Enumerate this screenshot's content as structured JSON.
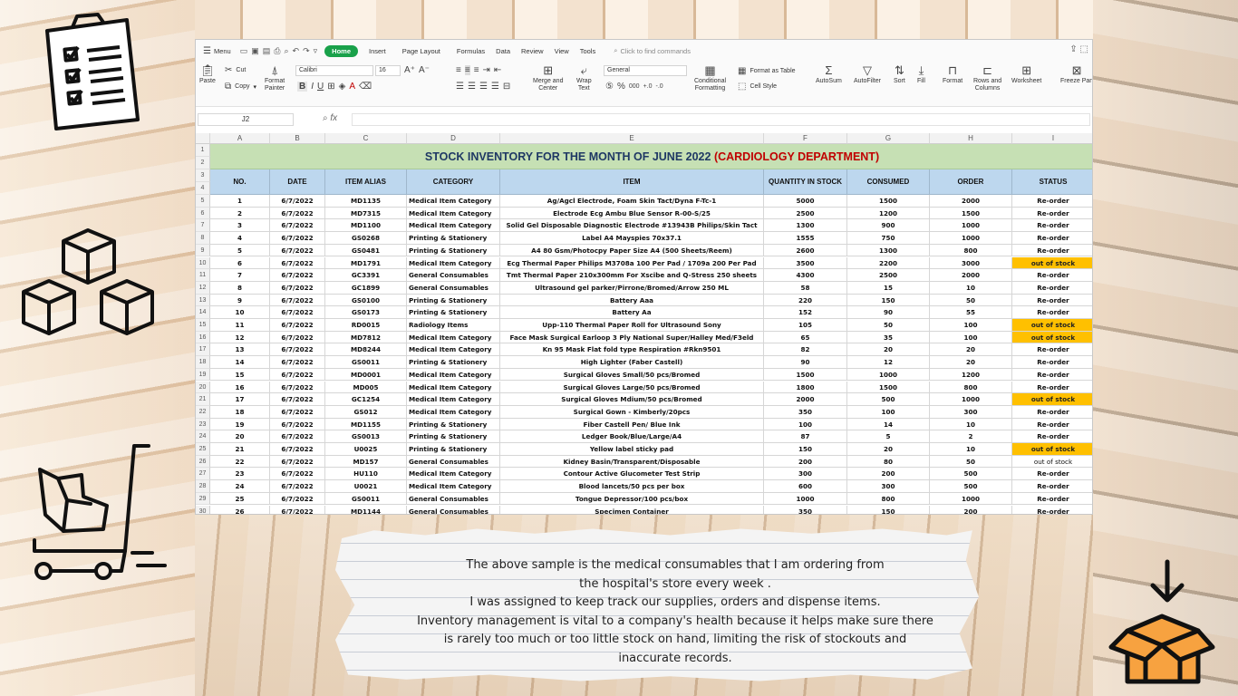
{
  "menubar": {
    "menu_label": "Menu",
    "tabs": [
      "Home",
      "Insert",
      "Page Layout",
      "Formulas",
      "Data",
      "Review",
      "View",
      "Tools"
    ],
    "search_placeholder": "Click to find commands"
  },
  "ribbon": {
    "paste": "Paste",
    "cut": "Cut",
    "copy": "Copy",
    "format_painter_1": "Format",
    "format_painter_2": "Painter",
    "font_name": "Calibri",
    "font_size": "16",
    "merge_1": "Merge and",
    "merge_2": "Center",
    "wrap_1": "Wrap",
    "wrap_2": "Text",
    "number_format": "General",
    "cond_1": "Conditional",
    "cond_2": "Formatting",
    "format_table": "Format as Table",
    "cell_style": "Cell Style",
    "autosum": "AutoSum",
    "autofilter": "AutoFilter",
    "sort": "Sort",
    "fill": "Fill",
    "format": "Format",
    "rows_cols_1": "Rows and",
    "rows_cols_2": "Columns",
    "worksheet": "Worksheet",
    "freeze": "Freeze Pan"
  },
  "formula_bar": {
    "cell_ref": "J2",
    "fx": "fx",
    "value": ""
  },
  "columns": [
    "A",
    "B",
    "C",
    "D",
    "E",
    "F",
    "G",
    "H",
    "I"
  ],
  "row_numbers": [
    "1",
    "2",
    "3",
    "4",
    "5",
    "6",
    "7",
    "8",
    "9",
    "10",
    "11",
    "12",
    "13",
    "14",
    "15",
    "16",
    "17",
    "18",
    "19",
    "20",
    "21",
    "22",
    "23",
    "24",
    "25",
    "26",
    "27",
    "28",
    "29",
    "30"
  ],
  "sheet": {
    "title_main": "STOCK INVENTORY FOR THE MONTH OF JUNE 2022 ",
    "title_dept": "(CARDIOLOGY DEPARTMENT)",
    "headers": [
      "NO.",
      "DATE",
      "ITEM ALIAS",
      "CATEGORY",
      "ITEM",
      "QUANTITY IN STOCK",
      "CONSUMED",
      "ORDER",
      "STATUS"
    ],
    "rows": [
      [
        "1",
        "6/7/2022",
        "MD1135",
        "Medical Item Category",
        "Ag/Agcl Electrode, Foam Skin Tact/Dyna F-Tc-1",
        "5000",
        "1500",
        "2000",
        "Re-order"
      ],
      [
        "2",
        "6/7/2022",
        "MD7315",
        "Medical Item Category",
        "Electrode Ecg Ambu Blue Sensor R-00-S/25",
        "2500",
        "1200",
        "1500",
        "Re-order"
      ],
      [
        "3",
        "6/7/2022",
        "MD1100",
        "Medical Item Category",
        "Solid Gel Disposable Diagnostic Electrode #13943B Philips/Skin Tact",
        "1300",
        "900",
        "1000",
        "Re-order"
      ],
      [
        "4",
        "6/7/2022",
        "GS0268",
        "Printing & Stationery",
        "Label A4 Mayspies 70x37.1",
        "1555",
        "750",
        "1000",
        "Re-order"
      ],
      [
        "5",
        "6/7/2022",
        "GS0481",
        "Printing & Stationery",
        "A4 80 Gsm/Photocpy Paper Size A4 (500 Sheets/Reem)",
        "2600",
        "1300",
        "800",
        "Re-order"
      ],
      [
        "6",
        "6/7/2022",
        "MD1791",
        "Medical Item Category",
        "Ecg Thermal Paper Philips M3708a 100 Per Pad / 1709a 200 Per Pad",
        "3500",
        "2200",
        "3000",
        "out of stock"
      ],
      [
        "7",
        "6/7/2022",
        "GC3391",
        "General Consumables",
        "Tmt Thermal Paper 210x300mm For Xscibe and Q-Stress 250 sheets",
        "4300",
        "2500",
        "2000",
        "Re-order"
      ],
      [
        "8",
        "6/7/2022",
        "GC1899",
        "General Consumables",
        "Ultrasound gel parker/Pirrone/Bromed/Arrow 250 ML",
        "58",
        "15",
        "10",
        "Re-order"
      ],
      [
        "9",
        "6/7/2022",
        "GS0100",
        "Printing & Stationery",
        "Battery Aaa",
        "220",
        "150",
        "50",
        "Re-order"
      ],
      [
        "10",
        "6/7/2022",
        "GS0173",
        "Printing & Stationery",
        "Battery Aa",
        "152",
        "90",
        "55",
        "Re-order"
      ],
      [
        "11",
        "6/7/2022",
        "RD0015",
        "Radiology Items",
        "Upp-110 Thermal Paper Roll for Ultrasound Sony",
        "105",
        "50",
        "100",
        "out of stock"
      ],
      [
        "12",
        "6/7/2022",
        "MD7812",
        "Medical Item Category",
        "Face Mask Surgical Earloop 3 Ply National Super/Halley Med/F3eld",
        "65",
        "35",
        "100",
        "out of stock"
      ],
      [
        "13",
        "6/7/2022",
        "MD8244",
        "Medical Item Category",
        "Kn 95 Mask Flat fold type Respiration #Rkn9501",
        "82",
        "20",
        "20",
        "Re-order"
      ],
      [
        "14",
        "6/7/2022",
        "GS0011",
        "Printing & Stationery",
        "High Lighter (Faber Castell)",
        "90",
        "12",
        "20",
        "Re-order"
      ],
      [
        "15",
        "6/7/2022",
        "MD0001",
        "Medical Item Category",
        "Surgical Gloves Small/50 pcs/Bromed",
        "1500",
        "1000",
        "1200",
        "Re-order"
      ],
      [
        "16",
        "6/7/2022",
        "MD005",
        "Medical Item Category",
        "Surgical Gloves Large/50 pcs/Bromed",
        "1800",
        "1500",
        "800",
        "Re-order"
      ],
      [
        "17",
        "6/7/2022",
        "GC1254",
        "Medical Item Category",
        "Surgical Gloves Mdium/50 pcs/Bromed",
        "2000",
        "500",
        "1000",
        "out of stock"
      ],
      [
        "18",
        "6/7/2022",
        "GS012",
        "Medical Item Category",
        "Surgical Gown - Kimberly/20pcs",
        "350",
        "100",
        "300",
        "Re-order"
      ],
      [
        "19",
        "6/7/2022",
        "MD1155",
        "Printing & Stationery",
        "Fiber Castell Pen/ Blue Ink",
        "100",
        "14",
        "10",
        "Re-order"
      ],
      [
        "20",
        "6/7/2022",
        "GS0013",
        "Printing & Stationery",
        "Ledger Book/Blue/Large/A4",
        "87",
        "5",
        "2",
        "Re-order"
      ],
      [
        "21",
        "6/7/2022",
        "U0025",
        "Printing & Stationery",
        "Yellow label sticky pad",
        "150",
        "20",
        "10",
        "out of stock"
      ],
      [
        "22",
        "6/7/2022",
        "MD157",
        "General Consumables",
        "Kidney Basin/Transparent/Disposable",
        "200",
        "80",
        "50",
        "out of stock"
      ],
      [
        "23",
        "6/7/2022",
        "HU110",
        "Medical Item Category",
        "Contour Active Glucometer Test Strip",
        "300",
        "200",
        "500",
        "Re-order"
      ],
      [
        "24",
        "6/7/2022",
        "U0021",
        "Medical Item Category",
        "Blood lancets/50 pcs per box",
        "600",
        "300",
        "500",
        "Re-order"
      ],
      [
        "25",
        "6/7/2022",
        "GS0011",
        "General Consumables",
        "Tongue Depressor/100 pcs/box",
        "1000",
        "800",
        "1000",
        "Re-order"
      ],
      [
        "26",
        "6/7/2022",
        "MD1144",
        "General Consumables",
        "Specimen Container",
        "350",
        "150",
        "200",
        "Re-order"
      ]
    ],
    "status_highlight": [
      false,
      false,
      false,
      false,
      false,
      true,
      false,
      false,
      false,
      false,
      true,
      true,
      false,
      false,
      false,
      false,
      true,
      false,
      false,
      false,
      true,
      false,
      false,
      false,
      false,
      false
    ]
  },
  "colors": {
    "title_band": "#c6e0b4",
    "header_band": "#bdd7ee",
    "out_of_stock": "#ffc000",
    "title_text": "#1f3864",
    "dept_text": "#c00000",
    "home_tab": "#19a14a"
  },
  "note": {
    "lines": [
      "The above sample is the medical consumables that I am ordering from",
      "the hospital's store every week .",
      "I was assigned to keep track our supplies, orders and dispense items.",
      "Inventory management is vital to a company's health because it helps make sure there",
      "is rarely too much or too little stock on hand, limiting the risk of stockouts and",
      "inaccurate records."
    ]
  },
  "decorations": [
    "clipboard-checklist-icon",
    "stacked-boxes-icon",
    "hand-truck-icon",
    "open-box-download-icon"
  ]
}
